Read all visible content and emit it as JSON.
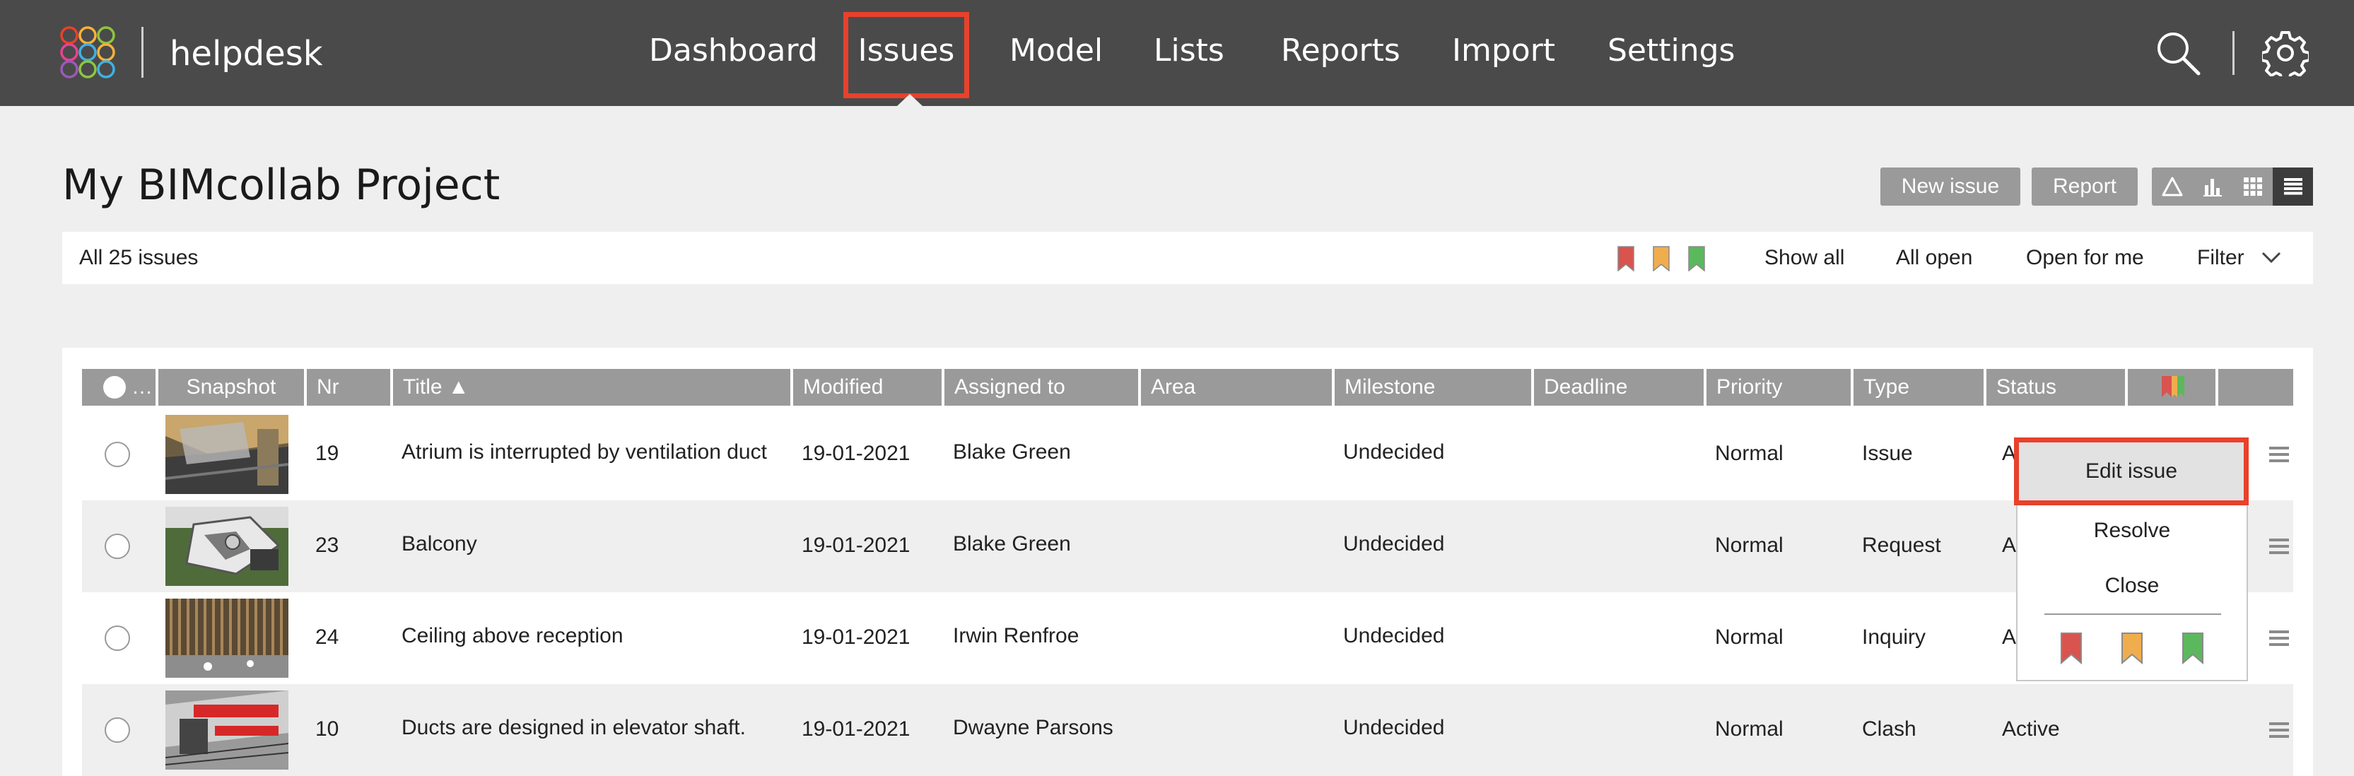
{
  "app": {
    "name": "helpdesk",
    "logo_colors": [
      "#e8412c",
      "#f6b23a",
      "#8cc63f",
      "#3fb1e3",
      "#9b59b6",
      "#e84393"
    ]
  },
  "nav": {
    "items": [
      {
        "label": "Dashboard"
      },
      {
        "label": "Issues",
        "active": true
      },
      {
        "label": "Model"
      },
      {
        "label": "Lists"
      },
      {
        "label": "Reports"
      },
      {
        "label": "Import"
      },
      {
        "label": "Settings"
      }
    ],
    "icons": [
      "search-icon",
      "gear-icon"
    ]
  },
  "project": {
    "title": "My BIMcollab Project",
    "new_issue_label": "New issue",
    "report_label": "Report",
    "views": [
      "triangle-view-icon",
      "bar-chart-view-icon",
      "grid-view-icon",
      "list-view-icon"
    ],
    "selected_view": "list-view-icon"
  },
  "filterbar": {
    "count_label": "All 25 issues",
    "flags": [
      "red-flag-icon",
      "orange-flag-icon",
      "green-flag-icon"
    ],
    "show_all": "Show all",
    "all_open": "All open",
    "open_for_me": "Open for me",
    "filter": "Filter"
  },
  "table": {
    "headers": {
      "select": "…",
      "snapshot": "Snapshot",
      "nr": "Nr",
      "title": "Title ▲",
      "modified": "Modified",
      "assigned": "Assigned to",
      "area": "Area",
      "milestone": "Milestone",
      "deadline": "Deadline",
      "priority": "Priority",
      "type": "Type",
      "status": "Status"
    },
    "rows": [
      {
        "nr": "19",
        "title": "Atrium is interrupted by ventilation duct",
        "modified": "19-01-2021",
        "assigned": "Blake Green",
        "area": "",
        "milestone": "Undecided",
        "deadline": "",
        "priority": "Normal",
        "type": "Issue",
        "status": "A"
      },
      {
        "nr": "23",
        "title": "Balcony",
        "modified": "19-01-2021",
        "assigned": "Blake Green",
        "area": "",
        "milestone": "Undecided",
        "deadline": "",
        "priority": "Normal",
        "type": "Request",
        "status": "A"
      },
      {
        "nr": "24",
        "title": "Ceiling above reception",
        "modified": "19-01-2021",
        "assigned": "Irwin Renfroe",
        "area": "",
        "milestone": "Undecided",
        "deadline": "",
        "priority": "Normal",
        "type": "Inquiry",
        "status": "A"
      },
      {
        "nr": "10",
        "title": "Ducts are designed in elevator shaft.",
        "modified": "19-01-2021",
        "assigned": "Dwayne Parsons",
        "area": "",
        "milestone": "Undecided",
        "deadline": "",
        "priority": "Normal",
        "type": "Clash",
        "status": "Active"
      }
    ]
  },
  "context_menu": {
    "edit": "Edit issue",
    "resolve": "Resolve",
    "close": "Close",
    "flags": [
      "red-flag-icon",
      "orange-flag-icon",
      "green-flag-icon"
    ]
  },
  "colors": {
    "topbar": "#4a4a4a",
    "highlight": "#e8412c",
    "flag_red": "#d9534f",
    "flag_orange": "#f0ad4e",
    "flag_green": "#5cb85c"
  }
}
